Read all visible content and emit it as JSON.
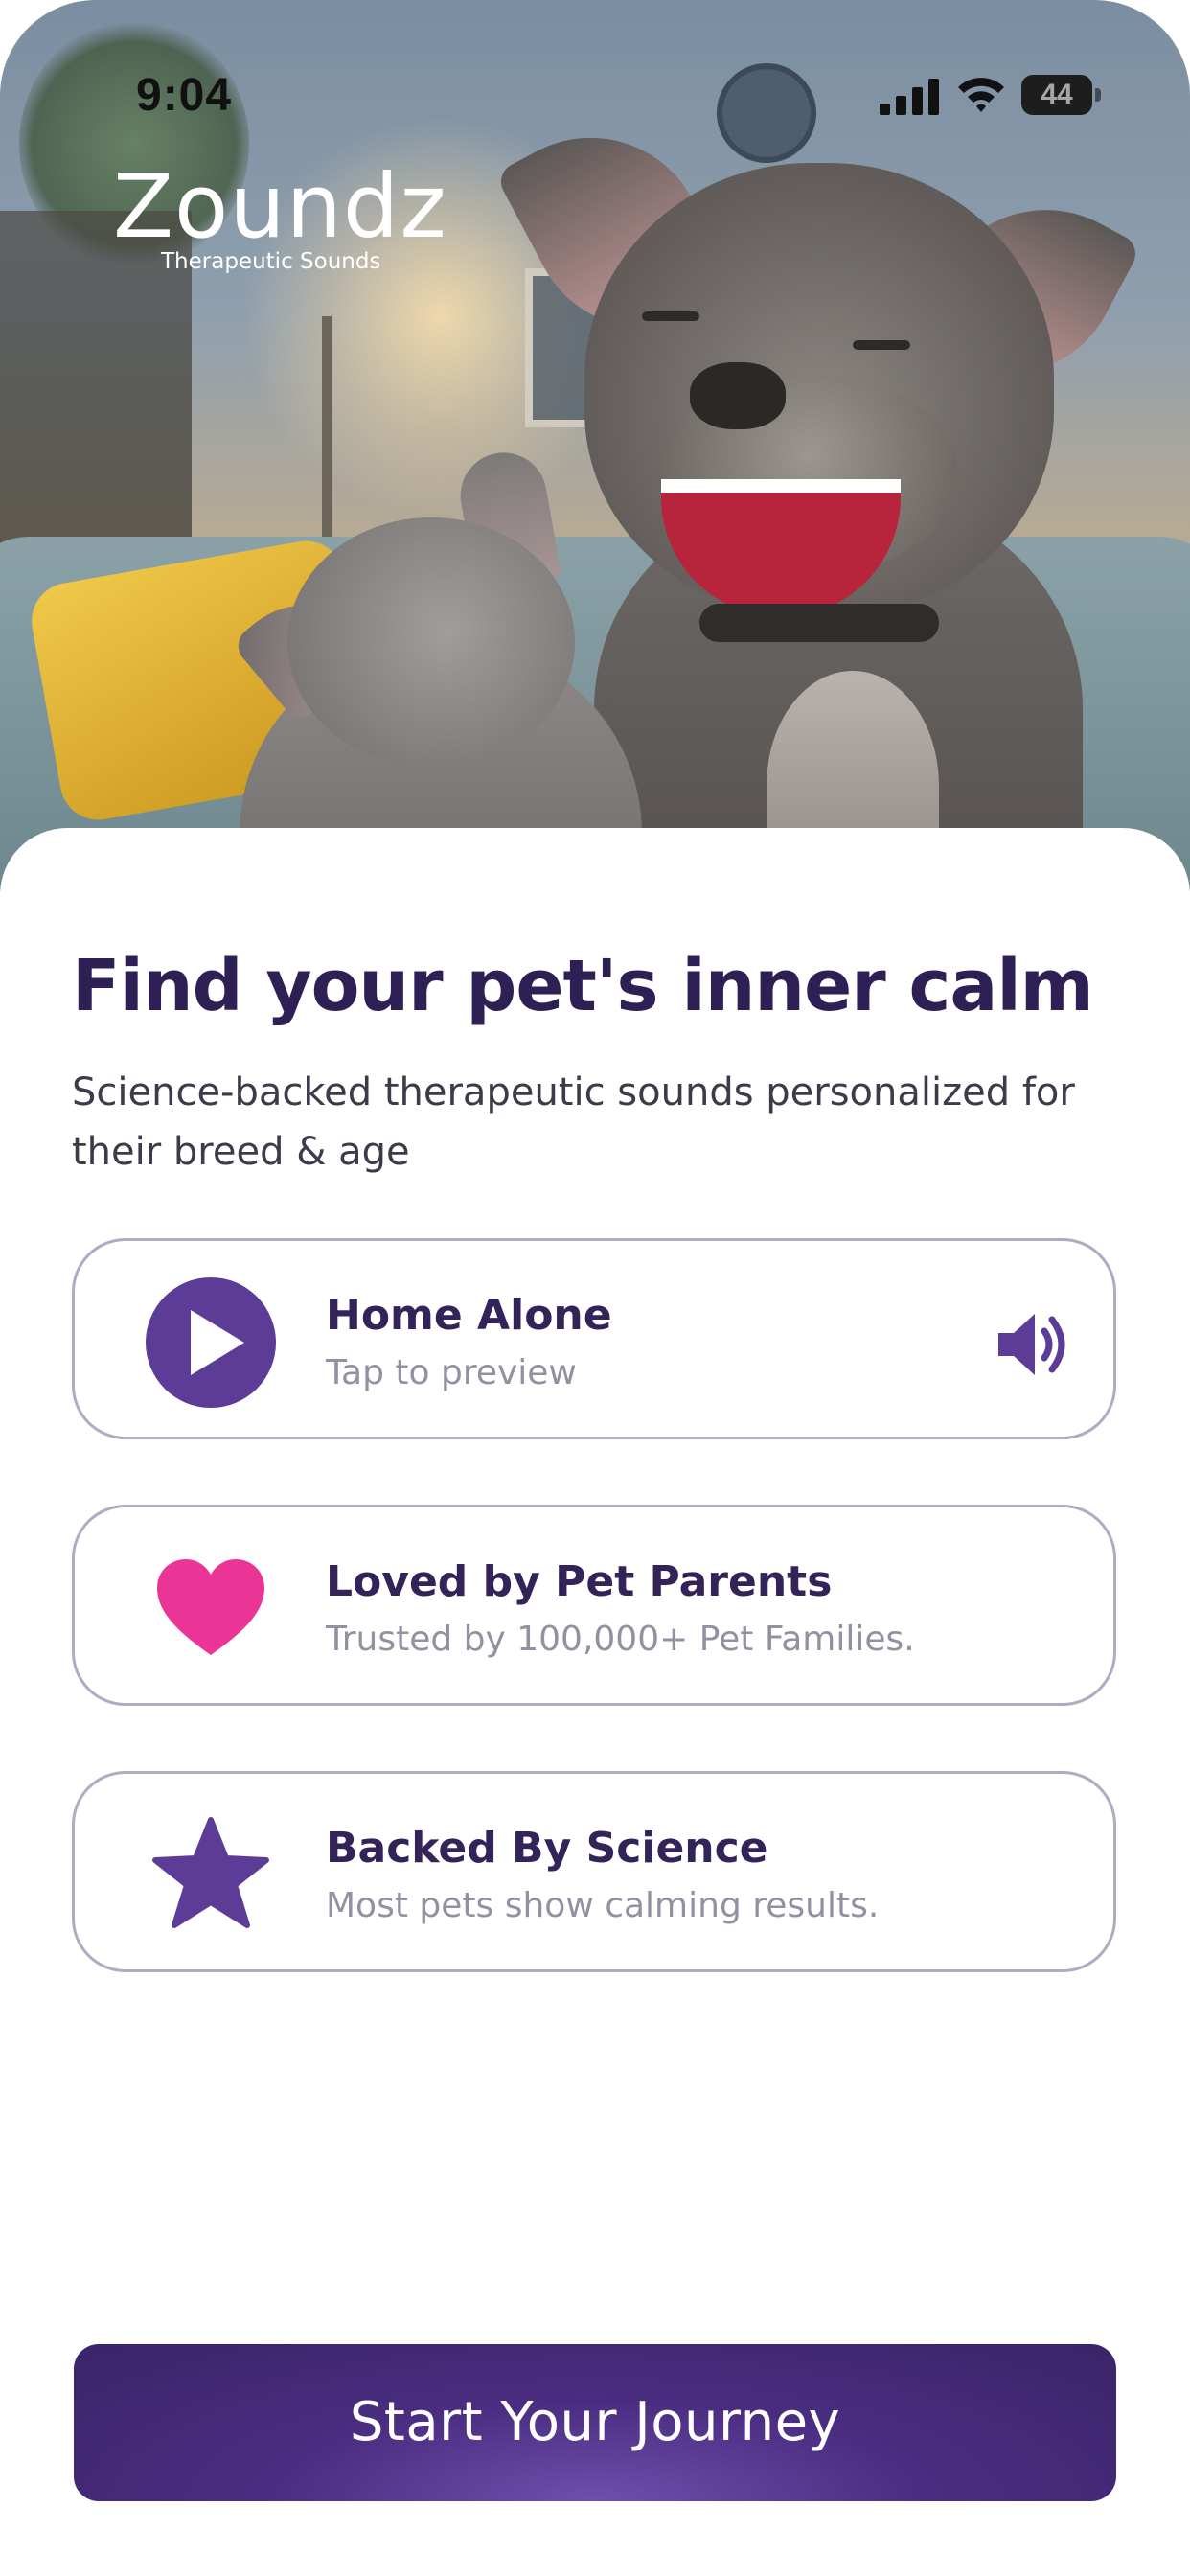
{
  "status_bar": {
    "time": "9:04",
    "battery": "44"
  },
  "brand": {
    "name": "Zoundz",
    "tagline": "Therapeutic Sounds"
  },
  "headline": "Find your pet's inner calm",
  "subheadline": "Science-backed therapeutic sounds personalized for their breed & age",
  "cards": [
    {
      "icon": "play-icon",
      "title": "Home Alone",
      "subtitle": "Tap to preview",
      "trailing_icon": "speaker-icon"
    },
    {
      "icon": "heart-icon",
      "title": "Loved by Pet Parents",
      "subtitle": "Trusted by 100,000+ Pet Families."
    },
    {
      "icon": "star-icon",
      "title": "Backed By Science",
      "subtitle": "Most pets show calming results."
    }
  ],
  "cta": {
    "label": "Start Your Journey"
  },
  "colors": {
    "primary": "#5d3c97",
    "heading": "#2e1f55",
    "heart": "#ea3596",
    "card_border": "#b1aac2",
    "muted": "#9490a2"
  }
}
